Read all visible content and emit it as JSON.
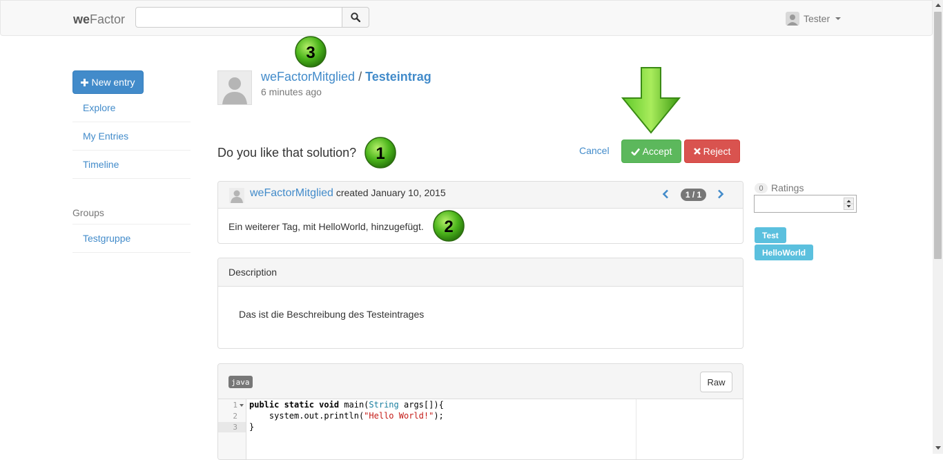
{
  "navbar": {
    "brand_bold": "we",
    "brand_rest": "Factor",
    "search": {
      "placeholder": "",
      "value": ""
    },
    "user": {
      "name": "Tester"
    }
  },
  "sidebar": {
    "new_entry_label": "New entry",
    "items": [
      {
        "label": "Explore"
      },
      {
        "label": "My Entries"
      },
      {
        "label": "Timeline"
      }
    ],
    "groups_heading": "Groups",
    "groups": [
      {
        "label": "Testgruppe"
      }
    ]
  },
  "entry": {
    "author": "weFactorMitglied",
    "separator": "/",
    "title": "Testeintrag",
    "time": "6 minutes ago"
  },
  "question": {
    "text": "Do you like that solution?",
    "cancel_label": "Cancel",
    "accept_label": "Accept",
    "reject_label": "Reject"
  },
  "markers": [
    {
      "number": "1"
    },
    {
      "number": "2"
    },
    {
      "number": "3"
    }
  ],
  "revision": {
    "author": "weFactorMitglied",
    "action": "created",
    "date": "January 10, 2015",
    "counter": "1 / 1",
    "message": "Ein weiterer Tag, mit HelloWorld, hinzugefügt."
  },
  "description": {
    "heading": "Description",
    "body": "Das ist die Beschreibung des Testeintrages"
  },
  "code": {
    "language": "java",
    "raw_label": "Raw",
    "line_numbers": [
      "1",
      "2",
      "3"
    ],
    "lines": [
      {
        "kw": "public static void",
        "name": " main(",
        "type": "String",
        "rest": " args[]){"
      },
      {
        "indent": "    system.out.println(",
        "string": "\"Hello World!\"",
        "end": ");"
      },
      {
        "text": "}"
      }
    ]
  },
  "ratings": {
    "count": "0",
    "label": "Ratings",
    "input_value": ""
  },
  "tags": [
    {
      "label": "Test"
    },
    {
      "label": "HelloWorld"
    }
  ],
  "colors": {
    "primary": "#428bca",
    "success": "#5cb85c",
    "danger": "#d9534f",
    "info": "#5bc0de",
    "marker_green": "#3fb618"
  },
  "icons": {
    "search": "search-icon",
    "user": "user-icon",
    "plus": "plus-icon",
    "check": "check-icon",
    "times": "times-icon",
    "chevron_left": "chevron-left-icon",
    "chevron_right": "chevron-right-icon",
    "arrow_down": "arrow-down-icon"
  }
}
